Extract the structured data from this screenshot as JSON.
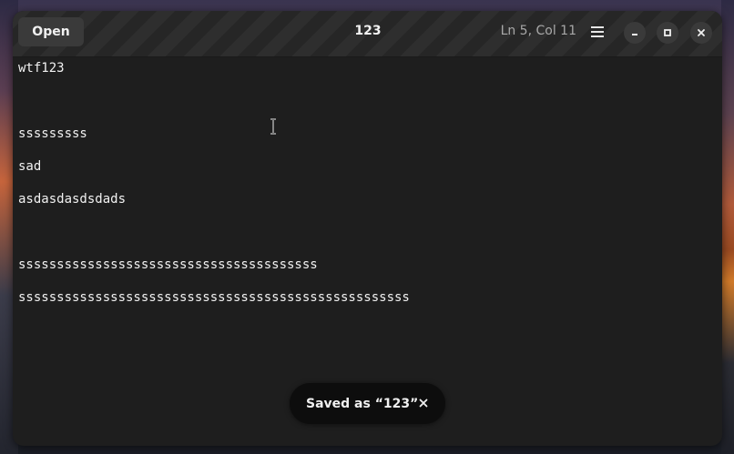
{
  "header": {
    "open_label": "Open",
    "title": "123",
    "cursor_position": "Ln 5, Col 11",
    "menu_icon": "hamburger-menu-icon",
    "minimize_icon": "minimize-icon",
    "maximize_icon": "maximize-icon",
    "close_icon": "close-icon"
  },
  "editor": {
    "lines": [
      "wtf123",
      "",
      "sssssssss",
      "sad",
      "asdasdasdsdads",
      "",
      "sssssssssssssssssssssssssssssssssssssss",
      "sssssssssssssssssssssssssssssssssssssssssssssssssss"
    ]
  },
  "toast": {
    "message": "Saved as “123”",
    "close_icon": "close-icon"
  },
  "colors": {
    "window_bg": "#1e1e1e",
    "header_bg": "#262626",
    "button_bg": "#3a3a3a",
    "text": "#f2f2f2",
    "muted_text": "#a8a8a8",
    "toast_bg": "#0d0d0d"
  }
}
